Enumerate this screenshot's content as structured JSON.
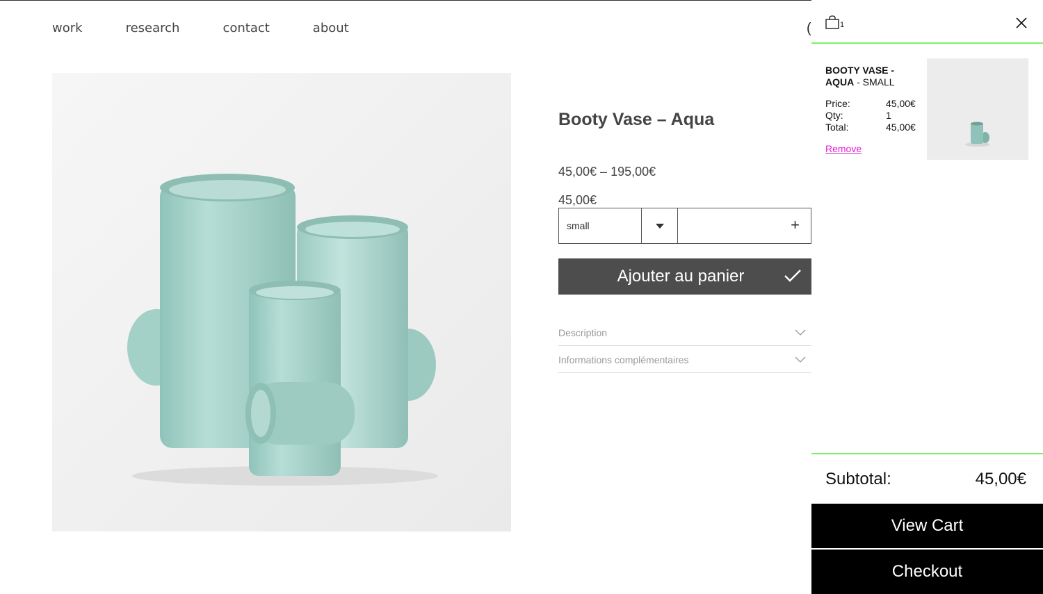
{
  "nav": {
    "items": [
      "work",
      "research",
      "contact",
      "about"
    ],
    "partial_glyph": "("
  },
  "product": {
    "title": "Booty Vase – Aqua",
    "price_range": "45,00€ – 195,00€",
    "price_current": "45,00€",
    "variant_selected": "small",
    "add_to_cart_label": "Ajouter au panier",
    "accordion": [
      "Description",
      "Informations complémentaires"
    ],
    "glaze_color": "#a9d5cc"
  },
  "cart": {
    "count": "1",
    "item": {
      "name_bold": "BOOTY VASE - AQUA",
      "variant": " - SMALL",
      "price_label": "Price:",
      "price_value": "45,00€",
      "qty_label": "Qty:",
      "qty_value": "1",
      "total_label": "Total:",
      "total_value": "45,00€",
      "remove_label": "Remove"
    },
    "subtotal_label": "Subtotal:",
    "subtotal_value": "45,00€",
    "view_cart_label": "View Cart",
    "checkout_label": "Checkout",
    "accent_color": "#7df06a",
    "remove_color": "#e020d0"
  }
}
